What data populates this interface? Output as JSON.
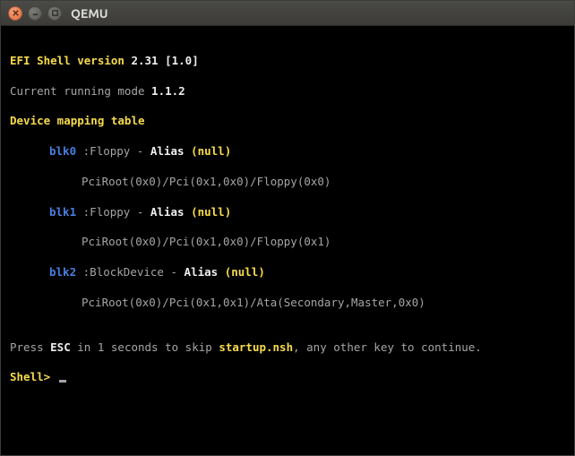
{
  "window": {
    "title": "QEMU"
  },
  "terminal": {
    "header_prefix": "EFI Shell version ",
    "header_version": "2.31 [1.0]",
    "mode_prefix": "Current running mode ",
    "mode_value": "1.1.2",
    "mapping_header": "Device mapping table",
    "devices": [
      {
        "id": "blk0",
        "sep": " :",
        "type": "Floppy",
        "dash": " - ",
        "alias_label": "Alias ",
        "alias_value": "(null)",
        "path": "PciRoot(0x0)/Pci(0x1,0x0)/Floppy(0x0)"
      },
      {
        "id": "blk1",
        "sep": " :",
        "type": "Floppy",
        "dash": " - ",
        "alias_label": "Alias ",
        "alias_value": "(null)",
        "path": "PciRoot(0x0)/Pci(0x1,0x0)/Floppy(0x1)"
      },
      {
        "id": "blk2",
        "sep": " :",
        "type": "BlockDevice",
        "dash": " - ",
        "alias_label": "Alias ",
        "alias_value": "(null)",
        "path": "PciRoot(0x0)/Pci(0x1,0x1)/Ata(Secondary,Master,0x0)"
      }
    ],
    "press_prefix": "Press ",
    "press_key": "ESC",
    "press_mid": " in 1 seconds to skip ",
    "press_script": "startup.nsh",
    "press_suffix": ", any other key to continue.",
    "prompt": "Shell> "
  }
}
